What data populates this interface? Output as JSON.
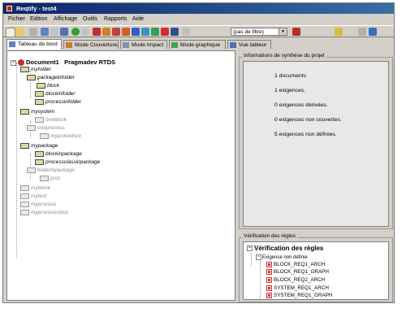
{
  "window": {
    "title": "Reqtify - test4"
  },
  "menu": [
    "Fichier",
    "Edition",
    "Affichage",
    "Outils",
    "Rapports",
    "Aide"
  ],
  "toolbar": {
    "filter": "(pas de filtre)"
  },
  "tabs": [
    "Tableau de bord",
    "Mode Couverture",
    "Mode Impact",
    "Mode graphique",
    "Vue tableur"
  ],
  "tree": {
    "root": "Document1",
    "root_suffix": "Pragmadev RTDS",
    "nodes": [
      "myfolder",
      "packageinfolder",
      "block",
      "blockinfolder",
      "processinfolder",
      "mysystem",
      "oneblock",
      "oneprocess",
      "myprocedure",
      "mypackage",
      "blockinpackage",
      "processclassinpackage",
      "folderinpackage",
      "proc",
      "myblock",
      "mytest",
      "myprocess",
      "myprocessclass"
    ]
  },
  "summary": {
    "group_label": "Informations de synthèse du projet",
    "lines": [
      "1 documents",
      "1 exigences.",
      "0 exigences dérivées.",
      "0 exigences non couvertes.",
      "5 exigences non définies."
    ]
  },
  "verification": {
    "group_label": "Vérification des règles",
    "title": "Vérification des règles",
    "subtitle": "Exigence non définie",
    "items": [
      "BLOCK_REQ1_ARCH",
      "BLOCK_REQ1_GRAPH",
      "BLOCK_REQ2_ARCH",
      "SYSTEM_REQ1_ARCH",
      "SYSTEM_REQ1_GRAPH"
    ]
  }
}
